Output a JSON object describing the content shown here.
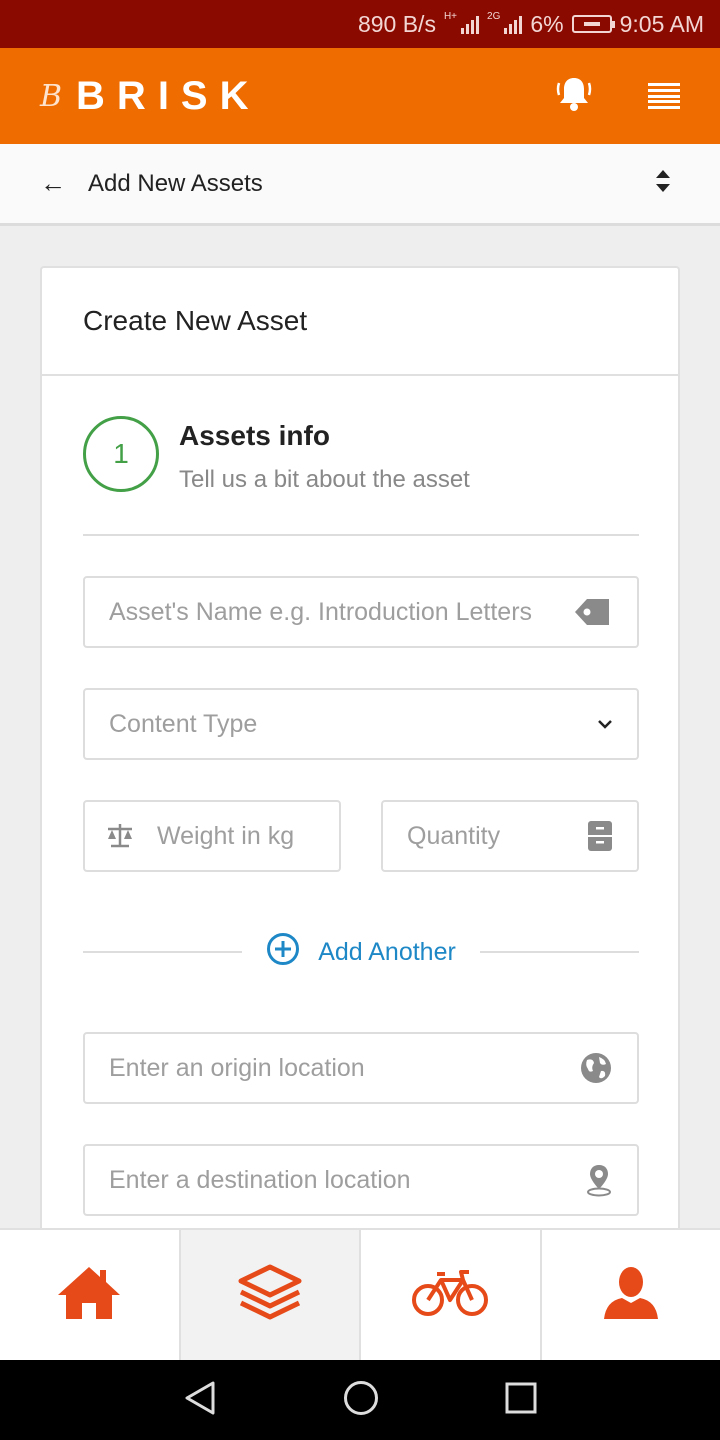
{
  "status_bar": {
    "net_speed": "890 B/s",
    "net_type_1": "H+",
    "net_type_2": "2G",
    "battery": "6%",
    "time": "9:05 AM"
  },
  "header": {
    "logo_text": "BRISK",
    "logo_mark": "B",
    "icons": [
      "bell-icon",
      "menu-icon"
    ]
  },
  "sub_header": {
    "title": "Add New Assets"
  },
  "card": {
    "title": "Create New Asset",
    "step": {
      "number": "1",
      "title": "Assets info",
      "description": "Tell us a bit about the asset"
    },
    "fields": {
      "asset_name_placeholder": "Asset's Name e.g. Introduction Letters",
      "content_type_placeholder": "Content Type",
      "weight_placeholder": "Weight in kg",
      "quantity_placeholder": "Quantity",
      "origin_placeholder": "Enter an origin location",
      "destination_placeholder": "Enter a destination location"
    },
    "add_another_label": "Add Another"
  },
  "bottom_nav": [
    {
      "icon": "home-icon",
      "active": false
    },
    {
      "icon": "layers-icon",
      "active": true
    },
    {
      "icon": "bicycle-icon",
      "active": false
    },
    {
      "icon": "user-icon",
      "active": false
    }
  ],
  "colors": {
    "status_bar": "#8b0a00",
    "header": "#ef6c00",
    "nav_icon": "#e64a19",
    "step": "#43a047",
    "link": "#1e88c7"
  }
}
